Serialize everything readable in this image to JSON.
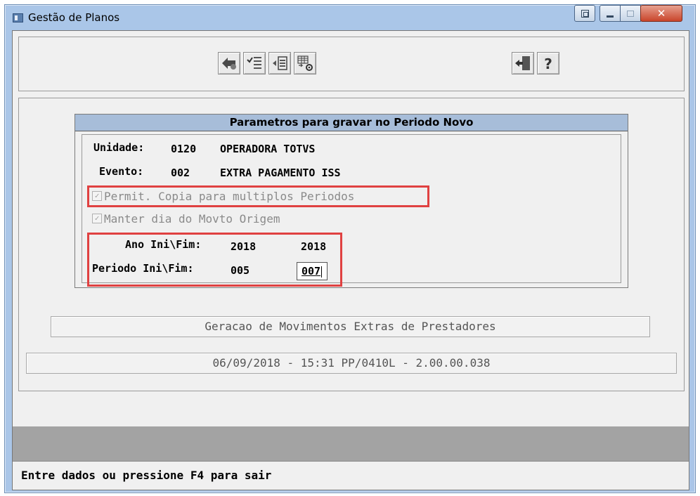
{
  "window": {
    "title": "Gestão de Planos"
  },
  "toolbar": {
    "buttons": [
      {
        "icon": "confirm-arrow-icon"
      },
      {
        "icon": "checklist-icon"
      },
      {
        "icon": "list-arrow-icon"
      },
      {
        "icon": "grid-settings-icon"
      },
      {
        "icon": "exit-door-icon"
      },
      {
        "icon": "help-icon"
      }
    ]
  },
  "dialog": {
    "title": "Parametros para gravar no Periodo Novo",
    "unidade_label": "Unidade:",
    "unidade_code": "0120",
    "unidade_name": "OPERADORA TOTVS",
    "evento_label": "Evento:",
    "evento_code": "002",
    "evento_name": "EXTRA PAGAMENTO ISS",
    "checkbox1": {
      "label": "Permit. Copia para multiplos Periodos",
      "checked": true,
      "enabled": false
    },
    "checkbox2": {
      "label": "Manter dia do Movto Origem",
      "checked": true,
      "enabled": false
    },
    "ano_label": "Ano Ini\\Fim:",
    "ano_ini": "2018",
    "ano_fim": "2018",
    "periodo_label": "Periodo Ini\\Fim:",
    "periodo_ini": "005",
    "periodo_fim": "007"
  },
  "program_title": "Geracao de Movimentos Extras de Prestadores",
  "version_info": "06/09/2018 - 15:31  PP/0410L - 2.00.00.038",
  "status_message": "Entre dados ou pressione F4 para sair",
  "colors": {
    "highlight": "#e04141",
    "header_bg": "#a7bdd9"
  }
}
